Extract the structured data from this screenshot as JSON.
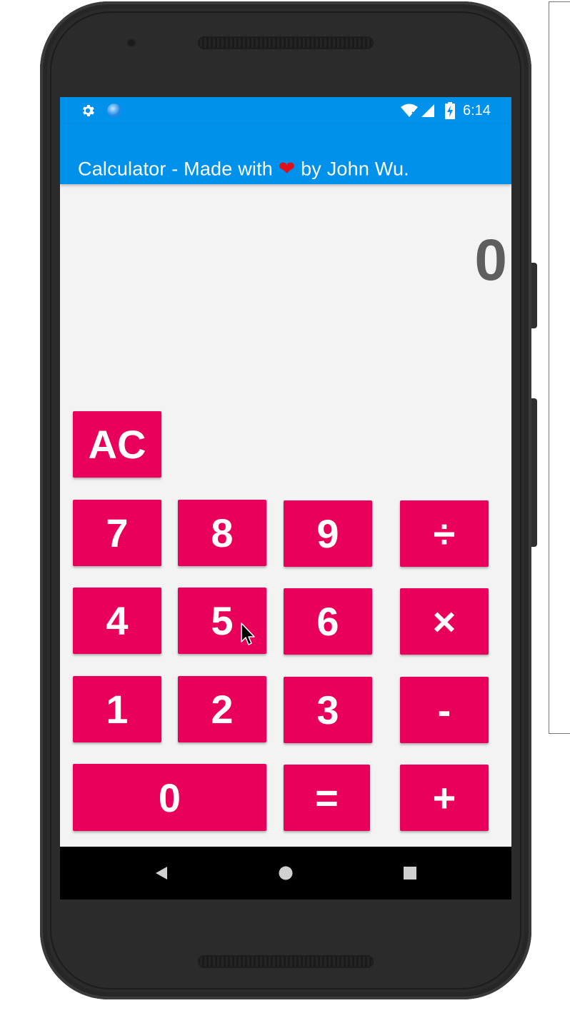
{
  "status_bar": {
    "time": "6:14",
    "left_icons": [
      "gear-icon",
      "sync-dot-icon"
    ],
    "right_icons": [
      "wifi-icon",
      "signal-icon",
      "battery-charging-icon"
    ]
  },
  "app_bar": {
    "title_prefix": "Calculator - Made with",
    "title_heart": "❤",
    "title_suffix": "by John Wu."
  },
  "display": {
    "value": "0"
  },
  "keypad": {
    "clear": "AC",
    "digits": {
      "d0": "0",
      "d1": "1",
      "d2": "2",
      "d3": "3",
      "d4": "4",
      "d5": "5",
      "d6": "6",
      "d7": "7",
      "d8": "8",
      "d9": "9"
    },
    "ops": {
      "divide": "÷",
      "multiply": "×",
      "subtract": "-",
      "add": "+",
      "equals": "="
    }
  },
  "nav_bar": {
    "icons": [
      "back-icon",
      "home-icon",
      "recents-icon"
    ]
  },
  "colors": {
    "app_bar": "#0091ea",
    "key": "#e8005a",
    "display_text": "#5e5e5e",
    "screen_bg": "#f3f3f3"
  }
}
